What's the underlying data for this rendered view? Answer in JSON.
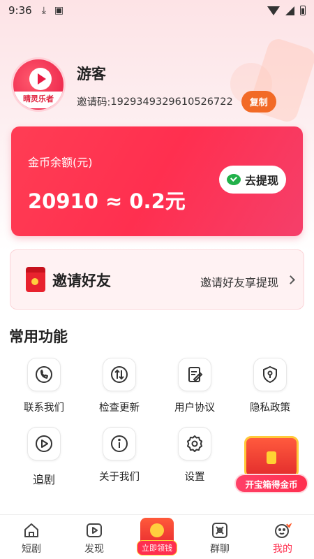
{
  "status_bar": {
    "time": "9:36"
  },
  "profile": {
    "avatar_brand": "晴灵乐者",
    "username": "游客",
    "invite_code_label": "邀请码: ",
    "invite_code": "1929349329610526722",
    "copy_label": "复制"
  },
  "balance": {
    "label": "金币余额(元)",
    "value": "20910 ≈ 0.2元",
    "withdraw_label": "去提现"
  },
  "invite": {
    "title": "邀请好友",
    "subtitle": "邀请好友享提现"
  },
  "functions": {
    "title": "常用功能",
    "items": [
      {
        "label": "联系我们",
        "icon": "phone-icon"
      },
      {
        "label": "检查更新",
        "icon": "update-icon"
      },
      {
        "label": "用户协议",
        "icon": "document-icon"
      },
      {
        "label": "隐私政策",
        "icon": "privacy-icon"
      },
      {
        "label": "追剧",
        "icon": "play-icon"
      },
      {
        "label": "关于我们",
        "icon": "info-icon"
      },
      {
        "label": "设置",
        "icon": "gear-icon"
      }
    ]
  },
  "treasure": {
    "label": "开宝箱得金币"
  },
  "bottom_nav": {
    "items": [
      {
        "label": "短剧",
        "icon": "home-icon"
      },
      {
        "label": "发现",
        "icon": "discover-icon"
      },
      {
        "label": "立即领钱",
        "icon": "earn-icon"
      },
      {
        "label": "群聊",
        "icon": "group-chat-icon"
      },
      {
        "label": "我的",
        "icon": "profile-icon"
      }
    ],
    "active_color": "#ff2a4a"
  }
}
